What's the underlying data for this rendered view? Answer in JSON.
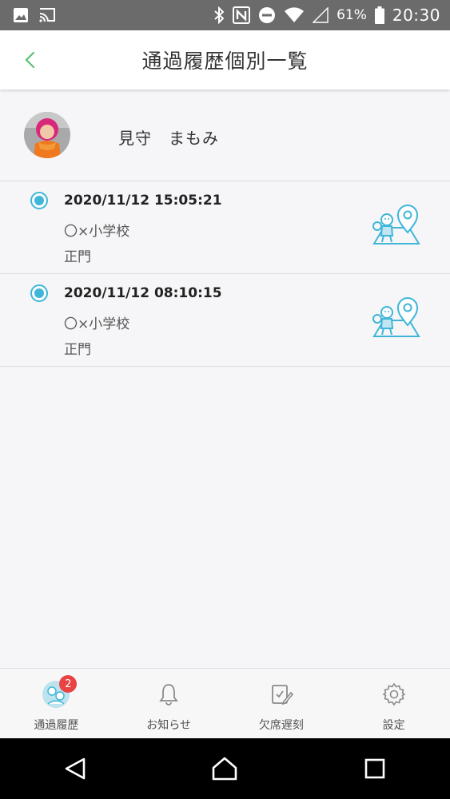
{
  "status_bar": {
    "battery": "61%",
    "time": "20:30",
    "icons": [
      "image-icon",
      "cast-icon",
      "bluetooth-icon",
      "nfc-icon",
      "do-not-disturb-icon",
      "wifi-icon",
      "signal-icon",
      "battery-icon"
    ]
  },
  "header": {
    "title": "通過履歴個別一覧",
    "back_icon": "chevron-left-icon",
    "accent_color": "#5cbf7a"
  },
  "profile": {
    "name": "見守　まもみ"
  },
  "history": [
    {
      "datetime": "2020/11/12 15:05:21",
      "location": "〇×小学校",
      "gate": "正門"
    },
    {
      "datetime": "2020/11/12 08:10:15",
      "location": "〇×小学校",
      "gate": "正門"
    }
  ],
  "bottom_nav": {
    "items": [
      {
        "label": "通過履歴",
        "icon": "history-icon",
        "badge": "2",
        "active": true
      },
      {
        "label": "お知らせ",
        "icon": "bell-icon"
      },
      {
        "label": "欠席遅刻",
        "icon": "clipboard-edit-icon"
      },
      {
        "label": "設定",
        "icon": "gear-icon"
      }
    ]
  },
  "colors": {
    "list_accent": "#3fb6d8",
    "badge": "#e84444"
  }
}
